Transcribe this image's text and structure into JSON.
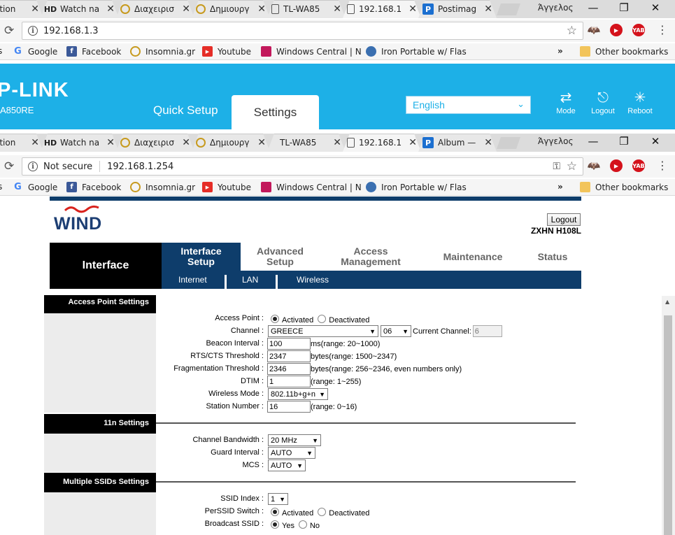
{
  "window1": {
    "tabs": [
      {
        "title": "ation",
        "favicon": "generic-icon"
      },
      {
        "title": "Watch na",
        "favicon": "hd-icon"
      },
      {
        "title": "Διαχειρισ",
        "favicon": "insomnia-icon"
      },
      {
        "title": "Δημιουργ",
        "favicon": "insomnia-icon"
      },
      {
        "title": "TL-WA85",
        "favicon": "page-icon"
      },
      {
        "title": "192.168.1",
        "favicon": "page-icon"
      },
      {
        "title": "Postimag",
        "favicon": "postimage-icon"
      }
    ],
    "profile": "Άγγελος",
    "url": "192.168.1.3"
  },
  "window2": {
    "tabs": [
      {
        "title": "ation",
        "favicon": "generic-icon"
      },
      {
        "title": "Watch na",
        "favicon": "hd-icon"
      },
      {
        "title": "Διαχειρισ",
        "favicon": "insomnia-icon"
      },
      {
        "title": "Δημιουργ",
        "favicon": "insomnia-icon"
      },
      {
        "title": "TL-WA85",
        "favicon": "page-icon"
      },
      {
        "title": "192.168.1",
        "favicon": "page-icon"
      },
      {
        "title": "Album —",
        "favicon": "postimage-icon"
      }
    ],
    "profile": "Άγγελος",
    "security": "Not secure",
    "url": "192.168.1.254"
  },
  "bookmarks": {
    "items": [
      "Google",
      "Facebook",
      "Insomnia.gr",
      "Youtube",
      "Windows Central | N",
      "Iron Portable w/ Flas"
    ],
    "more": "»",
    "other": "Other bookmarks"
  },
  "tplink": {
    "logo": "P-LINK",
    "model": "A850RE",
    "quick_setup": "Quick Setup",
    "settings": "Settings",
    "language": "English",
    "mode": "Mode",
    "logout": "Logout",
    "reboot": "Reboot",
    "brand_color": "#1db0e7"
  },
  "wind": {
    "logo": "WIND",
    "logout": "Logout",
    "model": "ZXHN H108L",
    "nav_title": "Interface",
    "tabs": [
      "Interface Setup",
      "Advanced Setup",
      "Access Management",
      "Maintenance",
      "Status"
    ],
    "subtabs": [
      "Internet",
      "LAN",
      "Wireless"
    ],
    "nav_color": "#0e3d6b"
  },
  "ap": {
    "section": "Access Point Settings",
    "access_point": {
      "label": "Access Point :",
      "activated": "Activated",
      "deactivated": "Deactivated",
      "selected": "Activated"
    },
    "channel": {
      "label": "Channel :",
      "region": "GREECE",
      "number": "06",
      "current_label": "Current Channel:",
      "current": "6"
    },
    "beacon": {
      "label": "Beacon Interval :",
      "value": "100",
      "hint": "ms(range: 20~1000)"
    },
    "rts": {
      "label": "RTS/CTS Threshold :",
      "value": "2347",
      "hint": "bytes(range: 1500~2347)"
    },
    "frag": {
      "label": "Fragmentation Threshold :",
      "value": "2346",
      "hint": "bytes(range: 256~2346, even numbers only)"
    },
    "dtim": {
      "label": "DTIM :",
      "value": "1",
      "hint": "(range: 1~255)"
    },
    "mode": {
      "label": "Wireless Mode :",
      "value": "802.11b+g+n"
    },
    "station": {
      "label": "Station Number :",
      "value": "16",
      "hint": "(range: 0~16)"
    }
  },
  "n11": {
    "section": "11n Settings",
    "bandwidth": {
      "label": "Channel Bandwidth :",
      "value": "20 MHz"
    },
    "guard": {
      "label": "Guard Interval :",
      "value": "AUTO"
    },
    "mcs": {
      "label": "MCS :",
      "value": "AUTO"
    }
  },
  "ssid": {
    "section": "Multiple SSIDs Settings",
    "index": {
      "label": "SSID Index :",
      "value": "1"
    },
    "perssid": {
      "label": "PerSSID Switch :",
      "activated": "Activated",
      "deactivated": "Deactivated",
      "selected": "Activated"
    },
    "broadcast": {
      "label": "Broadcast SSID :",
      "yes": "Yes",
      "no": "No",
      "selected": "Yes"
    }
  }
}
